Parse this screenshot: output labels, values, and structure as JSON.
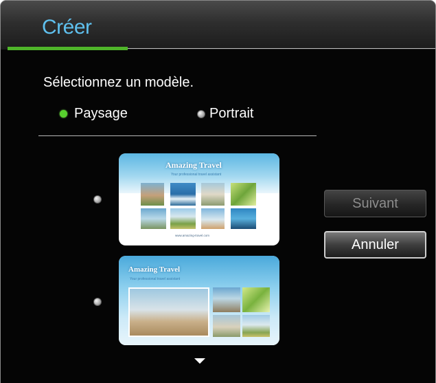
{
  "dialog": {
    "title": "Créer",
    "prompt": "Sélectionnez un modèle.",
    "orientation": {
      "options": [
        {
          "label": "Paysage",
          "selected": true
        },
        {
          "label": "Portrait",
          "selected": false
        }
      ]
    },
    "templates": [
      {
        "title": "Amazing Travel",
        "subtitle": "Your professional travel assistant",
        "footer": "www.amazing-travel.com",
        "selected": false
      },
      {
        "title": "Amazing Travel",
        "subtitle": "Your professional travel assistant",
        "selected": false
      }
    ],
    "buttons": {
      "next_label": "Suivant",
      "cancel_label": "Annuler"
    },
    "colors": {
      "title": "#5fc0ee",
      "accent": "#4fb52a",
      "selected_radio": "#58d12e",
      "background": "#050505"
    }
  }
}
